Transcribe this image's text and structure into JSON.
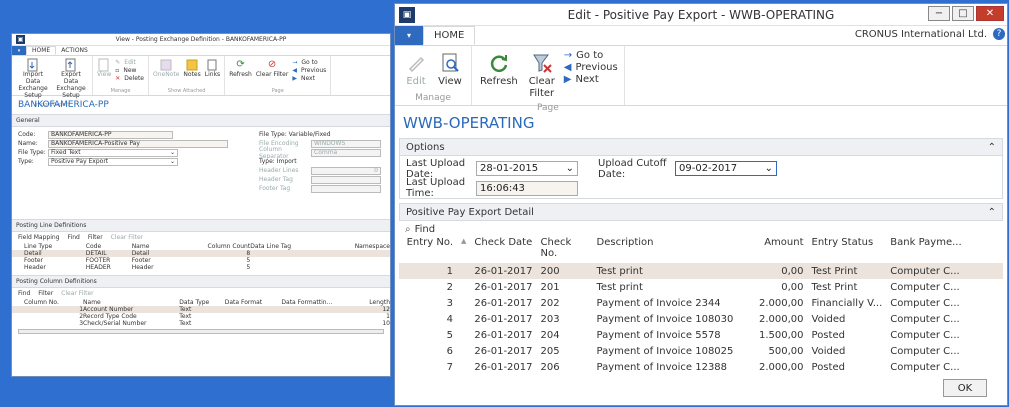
{
  "left_window": {
    "title": "View - Posting Exchange Definition - BANKOFAMERICA-PP",
    "tabs": [
      "HOME",
      "ACTIONS"
    ],
    "ribbon": {
      "import_data_exchange_setup": "Import Data Exchange Setup",
      "export_data_exchange_setup": "Export Data Exchange Setup",
      "group_import_export": "Import/Export",
      "view": "View",
      "edit": "Edit",
      "new": "New",
      "delete": "Delete",
      "group_manage": "Manage",
      "onenote": "OneNote",
      "notes": "Notes",
      "links": "Links",
      "group_show_attached": "Show Attached",
      "refresh": "Refresh",
      "clear_filter": "Clear Filter",
      "go_to": "Go to",
      "previous": "Previous",
      "next": "Next",
      "group_page": "Page"
    },
    "heading": "BANKOFAMERICA-PP",
    "general": {
      "section": "General",
      "code_label": "Code:",
      "code": "BANKOFAMERICA-PP",
      "name_label": "Name:",
      "name": "BANKOFAMERICA-Positive Pay",
      "file_type_label": "File Type:",
      "file_type": "Fixed Text",
      "type_label": "Type:",
      "type": "Positive Pay Export",
      "file_type_header": "File Type: Variable/Fixed",
      "file_encoding_label": "File Encoding",
      "file_encoding": "WINDOWS",
      "column_separator_label": "Column Separator",
      "column_separator": "Comma",
      "type_import_header": "Type: Import",
      "header_lines_label": "Header Lines",
      "header_lines": "0",
      "header_tag_label": "Header Tag",
      "footer_tag_label": "Footer Tag"
    },
    "line_definitions": {
      "section": "Posting Line Definitions",
      "toolbar": [
        "Field Mapping",
        "Find",
        "Filter",
        "Clear Filter"
      ],
      "headers": [
        "Line Type",
        "Code",
        "Name",
        "Column Count",
        "Data Line Tag",
        "Namespace"
      ],
      "rows": [
        [
          "Detail",
          "DETAIL",
          "Detail",
          "8"
        ],
        [
          "Footer",
          "FOOTER",
          "Footer",
          "5"
        ],
        [
          "Header",
          "HEADER",
          "Header",
          "5"
        ]
      ]
    },
    "column_definitions": {
      "section": "Posting Column Definitions",
      "toolbar": [
        "Find",
        "Filter",
        "Clear Filter"
      ],
      "headers": [
        "Column No.",
        "Name",
        "Data Type",
        "Data Format",
        "Data Formattin...",
        "Length"
      ],
      "rows": [
        [
          "1",
          "Account Number",
          "Text",
          "12"
        ],
        [
          "2",
          "Record Type Code",
          "Text",
          "1"
        ],
        [
          "3",
          "Check/Serial Number",
          "Text",
          "10"
        ]
      ]
    }
  },
  "window": {
    "title": "Edit - Positive Pay Export - WWB-OPERATING",
    "company": "CRONUS International Ltd.",
    "help": "?",
    "controls": {
      "min": "−",
      "max": "□",
      "close": "✕"
    }
  },
  "tabs": {
    "home": "HOME"
  },
  "ribbon": {
    "edit": "Edit",
    "view": "View",
    "group_manage": "Manage",
    "refresh": "Refresh",
    "clear_filter": "Clear Filter",
    "go_to": "Go to",
    "previous": "Previous",
    "next": "Next",
    "group_page": "Page"
  },
  "page_heading": "WWB-OPERATING",
  "options": {
    "title": "Options",
    "last_upload_date_label": "Last Upload Date:",
    "last_upload_date": "28-01-2015",
    "upload_cutoff_label": "Upload Cutoff Date:",
    "upload_cutoff": "09-02-2017",
    "last_upload_time_label": "Last Upload Time:",
    "last_upload_time": "16:06:43"
  },
  "detail": {
    "title": "Positive Pay Export Detail",
    "find": "Find",
    "headers": {
      "entry_no": "Entry No.",
      "check_date": "Check Date",
      "check_no": "Check No.",
      "description": "Description",
      "amount": "Amount",
      "entry_status": "Entry Status",
      "bank_payment": "Bank Payme..."
    },
    "rows": [
      {
        "entry": "1",
        "date": "26-01-2017",
        "check": "200",
        "desc": "Test print",
        "amount": "0,00",
        "status": "Test Print",
        "bank": "Computer C..."
      },
      {
        "entry": "2",
        "date": "26-01-2017",
        "check": "201",
        "desc": "Test print",
        "amount": "0,00",
        "status": "Test Print",
        "bank": "Computer C..."
      },
      {
        "entry": "3",
        "date": "26-01-2017",
        "check": "202",
        "desc": "Payment of Invoice 2344",
        "amount": "2.000,00",
        "status": "Financially V...",
        "bank": "Computer C..."
      },
      {
        "entry": "4",
        "date": "26-01-2017",
        "check": "203",
        "desc": "Payment of Invoice 108030",
        "amount": "2.000,00",
        "status": "Voided",
        "bank": "Computer C..."
      },
      {
        "entry": "5",
        "date": "26-01-2017",
        "check": "204",
        "desc": "Payment of Invoice 5578",
        "amount": "1.500,00",
        "status": "Posted",
        "bank": "Computer C..."
      },
      {
        "entry": "6",
        "date": "26-01-2017",
        "check": "205",
        "desc": "Payment of Invoice 108025",
        "amount": "500,00",
        "status": "Voided",
        "bank": "Computer C..."
      },
      {
        "entry": "7",
        "date": "26-01-2017",
        "check": "206",
        "desc": "Payment of Invoice 12388",
        "amount": "2.000,00",
        "status": "Posted",
        "bank": "Computer C..."
      }
    ]
  },
  "ok": "OK",
  "colors": {
    "desktop": "#2f6fd0",
    "accent": "#2d6ac0",
    "selected_row": "#ebe3dc"
  }
}
